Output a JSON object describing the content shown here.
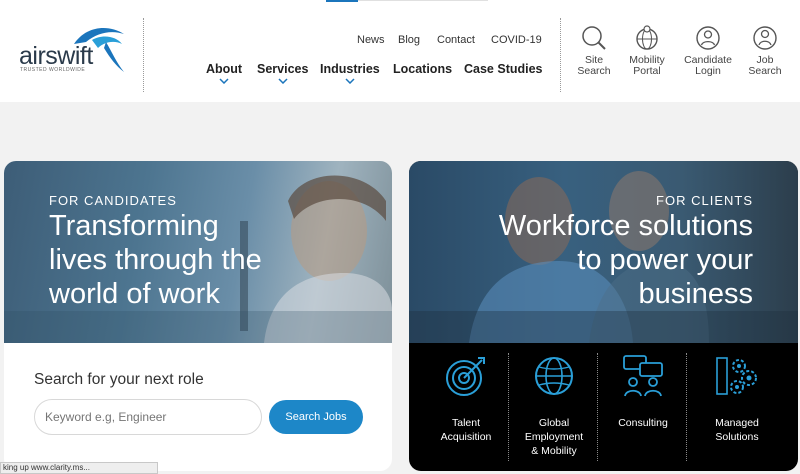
{
  "brand": {
    "name": "airswift",
    "tagline": "TRUSTED WORLDWIDE",
    "color": "#1b75bc"
  },
  "util_nav": [
    "News",
    "Blog",
    "Contact",
    "COVID-19"
  ],
  "main_nav": [
    {
      "label": "About",
      "has_dropdown": true
    },
    {
      "label": "Services",
      "has_dropdown": true
    },
    {
      "label": "Industries",
      "has_dropdown": true
    },
    {
      "label": "Locations",
      "has_dropdown": false
    },
    {
      "label": "Case Studies",
      "has_dropdown": false
    }
  ],
  "tools": [
    {
      "line1": "Site",
      "line2": "Search",
      "icon": "magnifier-icon"
    },
    {
      "line1": "Mobility",
      "line2": "Portal",
      "icon": "globe-person-icon"
    },
    {
      "line1": "Candidate",
      "line2": "Login",
      "icon": "person-circle-icon"
    },
    {
      "line1": "Job",
      "line2": "Search",
      "icon": "job-person-icon"
    }
  ],
  "candidates": {
    "eyebrow": "FOR CANDIDATES",
    "headline": [
      "Transforming",
      "lives through the",
      "world of work"
    ],
    "search_label": "Search for your next role",
    "search_placeholder": "Keyword e.g, Engineer",
    "search_button": "Search Jobs"
  },
  "clients": {
    "eyebrow": "FOR CLIENTS",
    "headline": [
      "Workforce solutions",
      "to power your",
      "business"
    ],
    "services": [
      {
        "lines": [
          "Talent",
          "Acquisition"
        ],
        "icon": "target-icon"
      },
      {
        "lines": [
          "Global",
          "Employment",
          "& Mobility"
        ],
        "icon": "globe-icon"
      },
      {
        "lines": [
          "Consulting"
        ],
        "icon": "chat-people-icon"
      },
      {
        "lines": [
          "Managed",
          "Solutions"
        ],
        "icon": "gears-icon"
      }
    ]
  },
  "status_text": "king up www.clarity.ms...",
  "colors": {
    "accent": "#1d87c8",
    "icon_blue": "#2a9fd8"
  }
}
